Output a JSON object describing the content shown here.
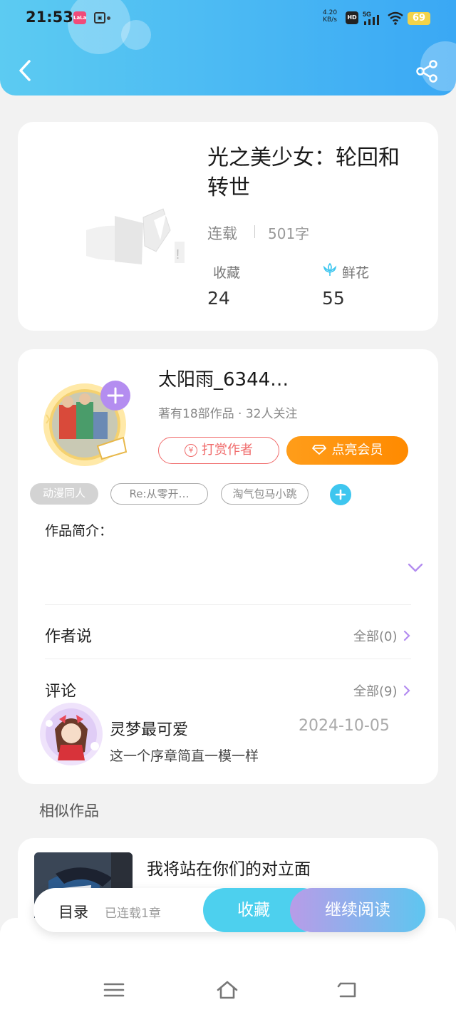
{
  "status_bar": {
    "time": "21:53",
    "app1": "LaLa",
    "net_speed_value": "4.20",
    "net_speed_unit": "KB/s",
    "hd": "HD",
    "signal": "5G",
    "battery": "69"
  },
  "header": {
    "back_icon": "chevron-left-icon",
    "share_icon": "share-icon"
  },
  "book": {
    "title": "光之美少女：轮回和转世",
    "status": "连载",
    "word_count": "501字",
    "favorites_label": "收藏",
    "favorites_count": "24",
    "flowers_label": "鲜花",
    "flowers_count": "55"
  },
  "author": {
    "name": "太阳雨_6344…",
    "meta": "著有18部作品 · 32人关注",
    "follow_icon": "plus-icon",
    "tip_label": "打赏作者",
    "tip_icon_glyph": "¥",
    "vip_label": "点亮会员"
  },
  "tags": [
    "动漫同人",
    "Re:从零开…",
    "淘气包马小跳"
  ],
  "intro": {
    "label": "作品简介："
  },
  "author_says": {
    "label": "作者说",
    "link": "全部(0)"
  },
  "comments": {
    "label": "评论",
    "link": "全部(9)",
    "items": [
      {
        "user": "灵梦最可爱",
        "date": "2024-10-05",
        "text": "这一个序章简直一模一样"
      }
    ]
  },
  "similar": {
    "label": "相似作品",
    "items": [
      {
        "title": "我将站在你们的对立面"
      }
    ]
  },
  "bottom_bar": {
    "toc_label": "目录",
    "toc_sub": "已连载1章",
    "favorite_label": "收藏",
    "read_label": "继续阅读"
  },
  "colors": {
    "header_start": "#5ccbf2",
    "header_end": "#3aa8f4",
    "accent_purple": "#b48df0",
    "accent_cyan": "#3ec6ef",
    "vip_orange": "#ff8a00",
    "tip_red": "#f06b6b"
  }
}
